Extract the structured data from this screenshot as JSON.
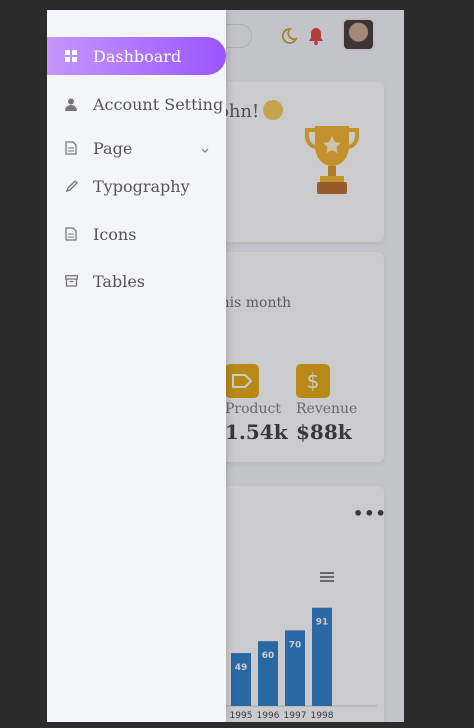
{
  "topbar": {
    "icons": [
      "moon-icon",
      "bell-icon"
    ],
    "accent": "#c99a2e",
    "bell_color": "#e03a3a"
  },
  "welcome_card": {
    "greeting": "ohn!"
  },
  "stats_card": {
    "subtitle": "this month",
    "stats": [
      {
        "label": "Product",
        "value": "1.54k",
        "icon": "tag-icon"
      },
      {
        "label": "Revenue",
        "value": "$88k",
        "icon": "dollar-icon"
      }
    ]
  },
  "chart_card": {
    "menu_icon": "more-dots-icon"
  },
  "chart_data": {
    "type": "bar",
    "categories": [
      "1995",
      "1996",
      "1997",
      "1998"
    ],
    "values": [
      49,
      60,
      70,
      91
    ],
    "color": "#1f77c4",
    "ylim": [
      0,
      100
    ]
  },
  "sidebar": {
    "accent_from": "#c496fb",
    "accent_to": "#9a55ff",
    "items": [
      {
        "label": "Dashboard",
        "icon": "grid-icon",
        "active": true
      },
      {
        "label": "Account Setting",
        "icon": "user-icon",
        "active": false
      },
      {
        "label": "Page",
        "icon": "document-icon",
        "active": false,
        "expandable": true
      },
      {
        "label": "Typography",
        "icon": "brush-icon",
        "active": false
      },
      {
        "label": "Icons",
        "icon": "document-icon",
        "active": false
      },
      {
        "label": "Tables",
        "icon": "archive-icon",
        "active": false
      }
    ]
  }
}
